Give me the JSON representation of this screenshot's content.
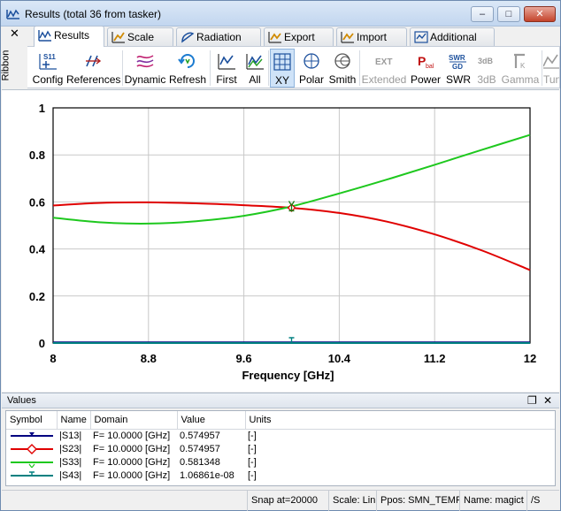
{
  "window": {
    "title": "Results (total 36 from tasker)",
    "minimize": "–",
    "maximize": "□",
    "close": "✕"
  },
  "ribbon": {
    "side_label": "Ribbon",
    "collapse": "✕",
    "tabs": [
      {
        "label": "Results",
        "icon": "results-tab-icon",
        "active": true
      },
      {
        "label": "Scale",
        "icon": "scale-tab-icon"
      },
      {
        "label": "Radiation",
        "icon": "radiation-tab-icon"
      },
      {
        "label": "Export",
        "icon": "export-tab-icon"
      },
      {
        "label": "Import",
        "icon": "import-tab-icon"
      },
      {
        "label": "Additional",
        "icon": "additional-tab-icon"
      }
    ],
    "tools": [
      {
        "label": "Config",
        "icon": "s11-config-icon",
        "enabled": true
      },
      {
        "label": "References",
        "icon": "references-icon",
        "enabled": true
      },
      {
        "label": "Dynamic",
        "icon": "dynamic-icon",
        "enabled": true
      },
      {
        "label": "Refresh",
        "icon": "refresh-icon",
        "enabled": true
      },
      {
        "label": "First",
        "icon": "first-icon",
        "enabled": true
      },
      {
        "label": "All",
        "icon": "all-icon",
        "enabled": true
      },
      {
        "label": "XY",
        "icon": "xy-grid-icon",
        "enabled": true,
        "pressed": true
      },
      {
        "label": "Polar",
        "icon": "polar-icon",
        "enabled": true
      },
      {
        "label": "Smith",
        "icon": "smith-icon",
        "enabled": true
      },
      {
        "label": "Extended",
        "icon": "ext-icon",
        "icon_text": "EXT",
        "enabled": false
      },
      {
        "label": "Power",
        "icon": "power-icon",
        "icon_text": "P",
        "icon_sub": "bal",
        "enabled": true
      },
      {
        "label": "SWR",
        "icon": "swr-icon",
        "icon_text": "SWR",
        "icon_sub": "GD",
        "enabled": true
      },
      {
        "label": "3dB",
        "icon": "3db-icon",
        "icon_text": "3dB",
        "enabled": false
      },
      {
        "label": "Gamma",
        "icon": "gamma-icon",
        "enabled": false
      },
      {
        "label": "Tuning",
        "icon": "tuning-icon",
        "enabled": false
      }
    ]
  },
  "chart_data": {
    "type": "line",
    "xlabel": "Frequency [GHz]",
    "ylabel": "",
    "xlim": [
      8,
      12
    ],
    "ylim": [
      0,
      1
    ],
    "x_ticks": [
      "8",
      "8.8",
      "9.6",
      "10.4",
      "11.2",
      "12"
    ],
    "y_ticks": [
      "0",
      "0.2",
      "0.4",
      "0.6",
      "0.8",
      "1"
    ],
    "grid": true,
    "marker_x": 10.0,
    "x": [
      8.0,
      8.4,
      8.8,
      9.2,
      9.6,
      10.0,
      10.4,
      10.8,
      11.2,
      11.6,
      12.0
    ],
    "series": [
      {
        "name": "|S13|",
        "color": "#000080",
        "values": [
          0.003,
          0.003,
          0.003,
          0.003,
          0.003,
          0.003,
          0.003,
          0.003,
          0.003,
          0.003,
          0.003
        ]
      },
      {
        "name": "|S23|",
        "color": "#e00000",
        "values": [
          0.585,
          0.596,
          0.598,
          0.594,
          0.586,
          0.575,
          0.553,
          0.516,
          0.462,
          0.393,
          0.31
        ]
      },
      {
        "name": "|S33|",
        "color": "#1ec81e",
        "values": [
          0.533,
          0.513,
          0.508,
          0.518,
          0.541,
          0.581,
          0.636,
          0.695,
          0.758,
          0.822,
          0.885
        ]
      },
      {
        "name": "|S43|",
        "color": "#008080",
        "values": [
          0.0,
          0.0,
          0.0,
          0.0,
          0.0,
          0.0,
          0.0,
          0.0,
          0.0,
          0.0,
          0.0
        ]
      }
    ]
  },
  "values_pane": {
    "title": "Values",
    "float_btn": "❐",
    "close_btn": "✕",
    "columns": [
      "Symbol",
      "Name",
      "Domain",
      "Value",
      "Units"
    ],
    "rows": [
      {
        "color": "#000080",
        "marker": "tri",
        "name": "|S13|",
        "domain": "F= 10.0000 [GHz]",
        "value": "0.574957",
        "units": "[-]"
      },
      {
        "color": "#e00000",
        "marker": "diamond",
        "name": "|S23|",
        "domain": "F= 10.0000 [GHz]",
        "value": "0.574957",
        "units": "[-]"
      },
      {
        "color": "#1ec81e",
        "marker": "v",
        "name": "|S33|",
        "domain": "F= 10.0000 [GHz]",
        "value": "0.581348",
        "units": "[-]"
      },
      {
        "color": "#008080",
        "marker": "t",
        "name": "|S43|",
        "domain": "F= 10.0000 [GHz]",
        "value": "1.06861e-08",
        "units": "[-]"
      }
    ]
  },
  "status": {
    "snap": "Snap at=20000",
    "scale": "Scale: Lin.",
    "ppos": "Ppos: SMN_TEMPL",
    "name": "Name: magict",
    "extra": "/S"
  }
}
